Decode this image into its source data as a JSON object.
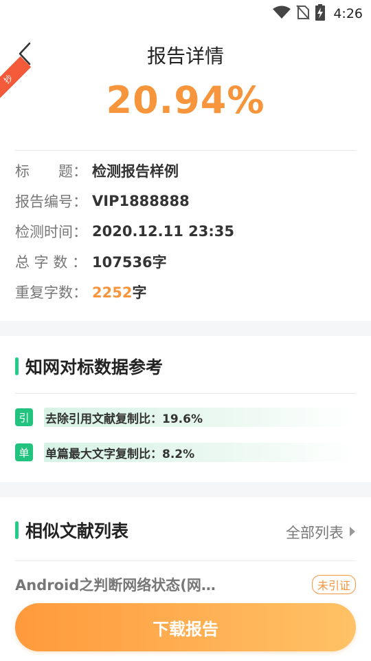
{
  "status_bar": {
    "time": "4:26",
    "icons": [
      "wifi-icon",
      "no-sim-icon",
      "battery-charging-icon"
    ]
  },
  "header": {
    "title": "报告详情",
    "back_icon": "chevron-left-icon"
  },
  "report": {
    "rate": "20.94%",
    "ribbon_text": "抄"
  },
  "info": {
    "title_label": "标　　题：",
    "title_value": "检测报告样例",
    "number_label": "报告编号：",
    "number_value": "VIP1888888",
    "time_label": "检测时间：",
    "time_value": "2020.12.11 23:35",
    "total_label": "总 字 数 ：",
    "total_value": "107536字",
    "repeat_label": "重复字数：",
    "repeat_value": "2252",
    "repeat_unit": "字"
  },
  "cnki_section": {
    "title": "知网对标数据参考",
    "rows": [
      {
        "badge": "引",
        "text": "去除引用文献复制比：19.6%"
      },
      {
        "badge": "单",
        "text": "单篇最大文字复制比：8.2%"
      }
    ]
  },
  "similar_section": {
    "title": "相似文献列表",
    "all_list_label": "全部列表",
    "items": [
      {
        "title": "Android之判断网络状态(网…",
        "tag": "未引证"
      }
    ]
  },
  "actions": {
    "download_label": "下载报告"
  },
  "colors": {
    "accent_orange": "#f7953c",
    "accent_green": "#22c37f",
    "ribbon_red": "#f35a3a"
  }
}
